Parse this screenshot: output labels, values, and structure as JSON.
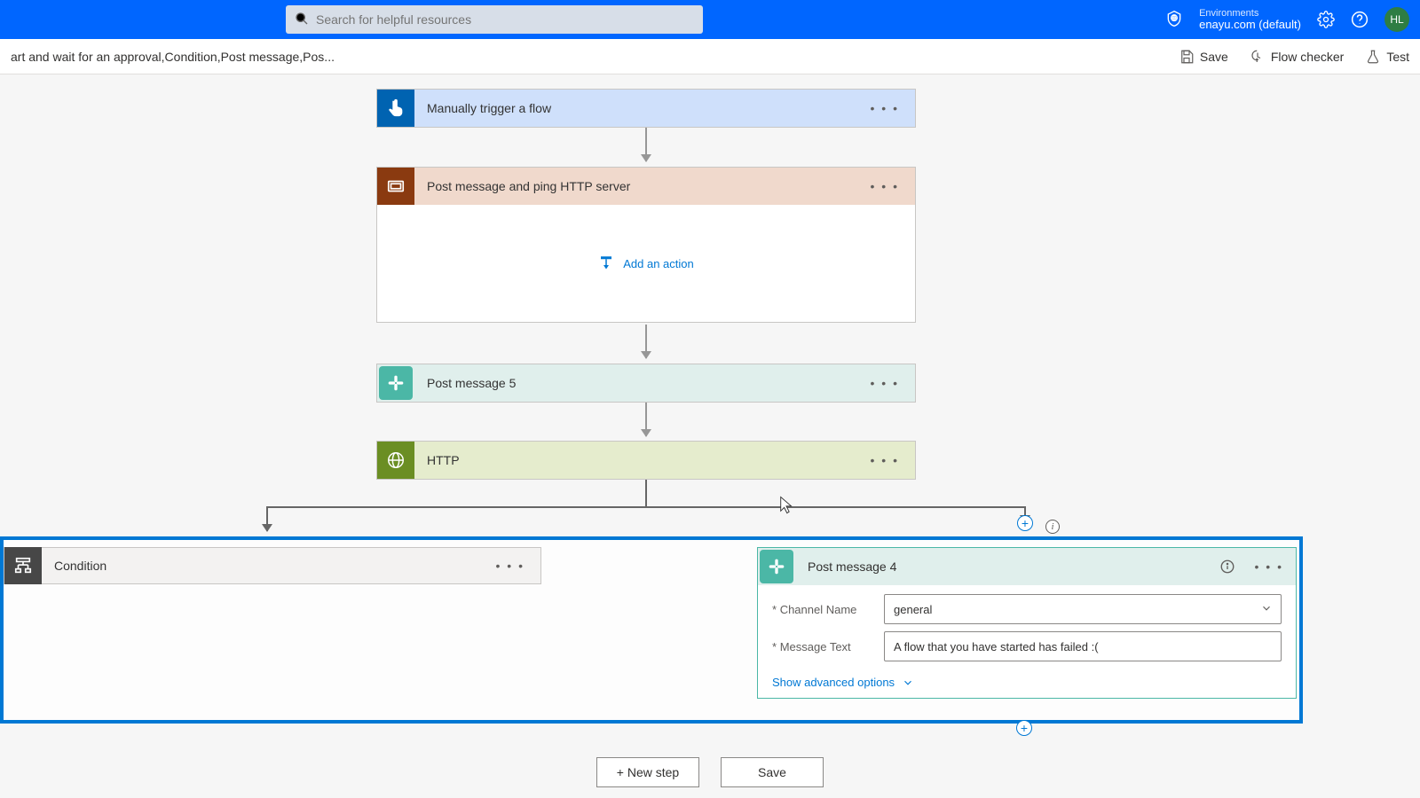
{
  "header": {
    "search_placeholder": "Search for helpful resources",
    "environments_label": "Environments",
    "environment_name": "enayu.com (default)",
    "avatar_initials": "HL"
  },
  "subbar": {
    "breadcrumb": "art and wait for an approval,Condition,Post message,Pos...",
    "save_label": "Save",
    "flow_checker_label": "Flow checker",
    "test_label": "Test"
  },
  "steps": {
    "trigger_title": "Manually trigger a flow",
    "scope_title": "Post message and ping HTTP server",
    "add_action_label": "Add an action",
    "post5_title": "Post message 5",
    "http_title": "HTTP"
  },
  "parallel": {
    "condition_title": "Condition",
    "post4_title": "Post message 4",
    "channel_label": "Channel Name",
    "channel_value": "general",
    "message_label": "Message Text",
    "message_value": "A flow that you have started has failed :(",
    "advanced_label": "Show advanced options"
  },
  "bottom": {
    "new_step_label": "+ New step",
    "save_label": "Save"
  }
}
